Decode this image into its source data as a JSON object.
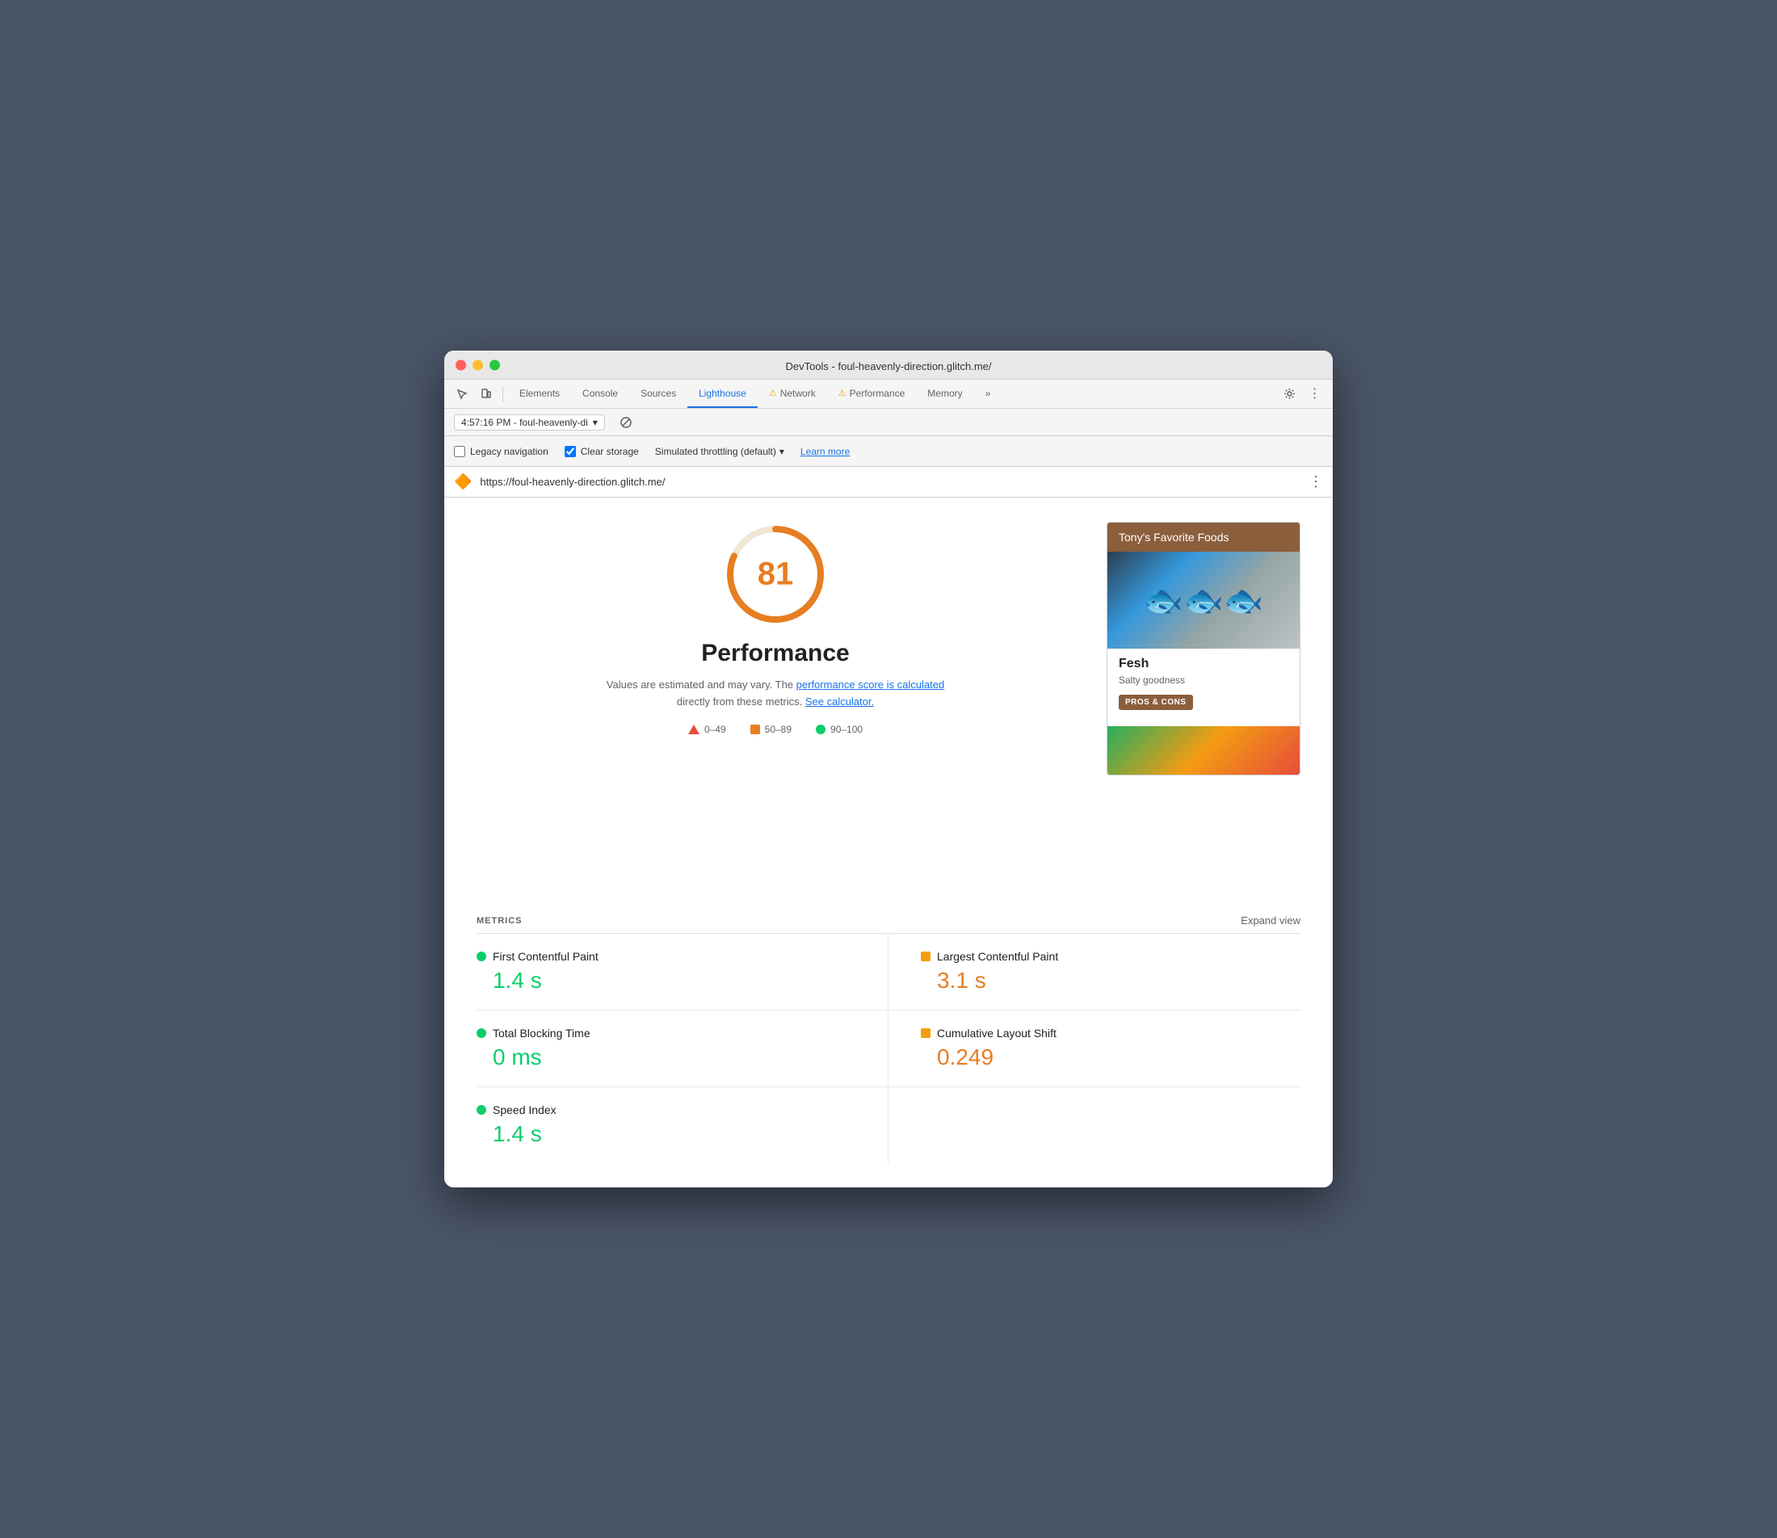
{
  "window": {
    "title": "DevTools - foul-heavenly-direction.glitch.me/"
  },
  "tabs": [
    {
      "label": "Elements",
      "active": false,
      "warning": false
    },
    {
      "label": "Console",
      "active": false,
      "warning": false
    },
    {
      "label": "Sources",
      "active": false,
      "warning": false
    },
    {
      "label": "Lighthouse",
      "active": true,
      "warning": false
    },
    {
      "label": "Network",
      "active": false,
      "warning": true
    },
    {
      "label": "Performance",
      "active": false,
      "warning": true
    },
    {
      "label": "Memory",
      "active": false,
      "warning": false
    }
  ],
  "session": {
    "time": "4:57:16 PM",
    "site": "foul-heavenly-di"
  },
  "options": {
    "legacy_nav_label": "Legacy navigation",
    "legacy_nav_checked": false,
    "clear_storage_label": "Clear storage",
    "clear_storage_checked": true,
    "throttling_label": "Simulated throttling (default)",
    "learn_more_label": "Learn more"
  },
  "url_bar": {
    "url": "https://foul-heavenly-direction.glitch.me/"
  },
  "score": {
    "value": 81,
    "label": "Performance",
    "description_start": "Values are estimated and may vary. The",
    "link1_text": "performance score is calculated",
    "description_mid": "directly from these metrics.",
    "link2_text": "See calculator.",
    "color": "#e67e22"
  },
  "legend": [
    {
      "type": "triangle",
      "range": "0–49"
    },
    {
      "type": "square",
      "range": "50–89"
    },
    {
      "type": "dot",
      "color": "#0cce6b",
      "range": "90–100"
    }
  ],
  "preview": {
    "site_name": "Tony's Favorite Foods",
    "food_name": "Fesh",
    "food_desc": "Salty goodness",
    "button_label": "PROS & CONS"
  },
  "metrics": {
    "section_label": "METRICS",
    "expand_label": "Expand view",
    "items": [
      {
        "name": "First Contentful Paint",
        "value": "1.4 s",
        "color_type": "dot",
        "color": "green",
        "position": "left"
      },
      {
        "name": "Largest Contentful Paint",
        "value": "3.1 s",
        "color_type": "square",
        "color": "orange",
        "position": "right"
      },
      {
        "name": "Total Blocking Time",
        "value": "0 ms",
        "color_type": "dot",
        "color": "green",
        "position": "left"
      },
      {
        "name": "Cumulative Layout Shift",
        "value": "0.249",
        "color_type": "square",
        "color": "orange",
        "position": "right"
      },
      {
        "name": "Speed Index",
        "value": "1.4 s",
        "color_type": "dot",
        "color": "green",
        "position": "left"
      }
    ]
  }
}
